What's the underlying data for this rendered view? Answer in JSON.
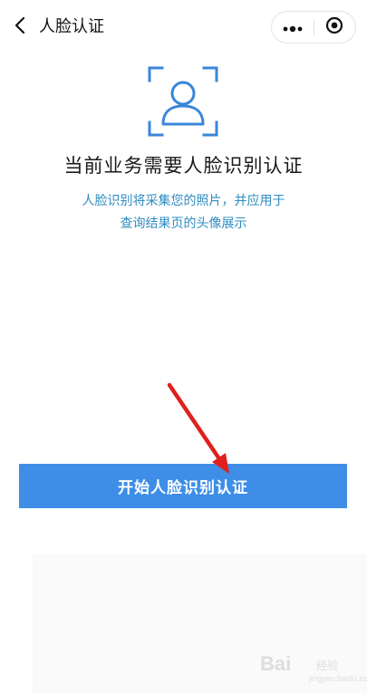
{
  "header": {
    "title": "人脸认证",
    "back_icon": "chevron-left-icon",
    "more_icon": "more-dots-icon",
    "close_icon": "target-circle-icon"
  },
  "face_icon": "face-scan-icon",
  "main": {
    "title": "当前业务需要人脸识别认证",
    "desc_line1": "人脸识别将采集您的照片，并应用于",
    "desc_line2": "查询结果页的头像展示"
  },
  "button": {
    "label": "开始人脸识别认证"
  },
  "colors": {
    "accent": "#3e8ee8",
    "desc_text": "#2f8cc0",
    "icon_blue": "#3a86d8",
    "annotation_arrow": "#e0201c"
  },
  "watermark": {
    "main": "Bai",
    "sub": "经验",
    "url": "jingyan.baidu.com"
  }
}
